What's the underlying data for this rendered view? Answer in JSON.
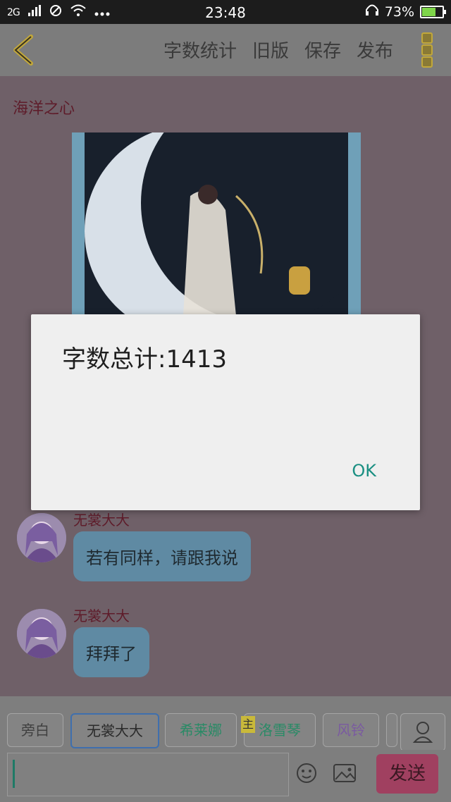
{
  "status_bar": {
    "network": "2G",
    "time": "23:48",
    "battery": "73%",
    "battery_level": 0.73,
    "icons": [
      "signal-icon",
      "no-disturb-icon",
      "wifi-icon",
      "more-dots-icon",
      "headphones-icon",
      "battery-icon"
    ]
  },
  "toolbar": {
    "word_count_label": "字数统计",
    "old_version_label": "旧版",
    "save_label": "保存",
    "publish_label": "发布"
  },
  "story": {
    "title": "海洋之心"
  },
  "messages": [
    {
      "name": "无裳大大",
      "text": "若有同样，请跟我说"
    },
    {
      "name": "无裳大大",
      "text": "拜拜了"
    }
  ],
  "characters": {
    "chips": [
      "旁白",
      "无裳大大",
      "希莱娜",
      "洛雪琴",
      "风铃"
    ],
    "main_tag": "主"
  },
  "input": {
    "value": "",
    "send_label": "发送"
  },
  "dialog": {
    "message": "字数总计:1413",
    "ok_label": "OK"
  },
  "colors": {
    "accent_teal": "#1a8f82",
    "send_button": "#a04060",
    "bubble": "#5f8aa3",
    "name_text": "#5e1c2a"
  }
}
